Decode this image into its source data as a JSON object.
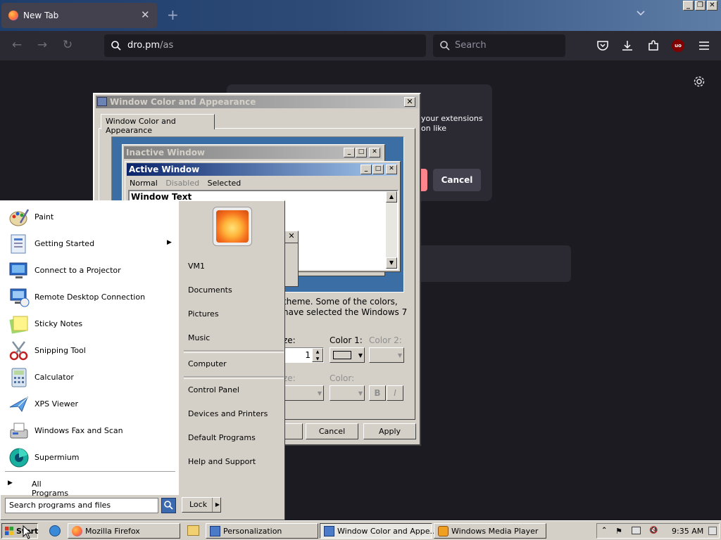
{
  "browser": {
    "tab_title": "New Tab",
    "url_host": "dro.pm",
    "url_path": "/as",
    "search_placeholder": "Search",
    "window_controls": [
      "minimize",
      "restore",
      "close"
    ],
    "extension_message_line1": "your extensions",
    "extension_message_line2": "on like",
    "extension_cancel": "Cancel",
    "addon_badge": "uo"
  },
  "dialog": {
    "title": "Window Color and Appearance",
    "tab": "Window Color and Appearance",
    "preview": {
      "inactive_title": "Inactive Window",
      "active_title": "Active Window",
      "menu_normal": "Normal",
      "menu_disabled": "Disabled",
      "menu_selected": "Selected",
      "window_text": "Window Text"
    },
    "desc_line1": "theme.  Some of the colors,",
    "desc_line2": "have selected the Windows 7",
    "size_label_1": "ze:",
    "size_value": "1",
    "color1_label": "Color 1:",
    "color2_label": "Color 2:",
    "size_label_2": "ze:",
    "color_label": "Color:",
    "bold_label": "B",
    "italic_label": "I",
    "buttons": {
      "cancel": "Cancel",
      "apply": "Apply"
    }
  },
  "start_menu": {
    "programs": [
      {
        "label": "Paint",
        "icon": "paint-icon"
      },
      {
        "label": "Getting Started",
        "icon": "getting-started-icon",
        "submenu": true
      },
      {
        "label": "Connect to a Projector",
        "icon": "projector-icon"
      },
      {
        "label": "Remote Desktop Connection",
        "icon": "remote-desktop-icon"
      },
      {
        "label": "Sticky Notes",
        "icon": "sticky-notes-icon"
      },
      {
        "label": "Snipping Tool",
        "icon": "scissors-icon"
      },
      {
        "label": "Calculator",
        "icon": "calculator-icon"
      },
      {
        "label": "XPS Viewer",
        "icon": "xps-viewer-icon"
      },
      {
        "label": "Windows Fax and Scan",
        "icon": "fax-icon"
      },
      {
        "label": "Supermium",
        "icon": "supermium-icon"
      }
    ],
    "all_programs": "All Programs",
    "search_placeholder": "Search programs and files",
    "right_links": {
      "user": "VM1",
      "documents": "Documents",
      "pictures": "Pictures",
      "music": "Music",
      "computer": "Computer",
      "control_panel": "Control Panel",
      "devices": "Devices and Printers",
      "defaults": "Default Programs",
      "help": "Help and Support"
    },
    "lock_label": "Lock"
  },
  "taskbar": {
    "start_label": "Start",
    "buttons": [
      {
        "label": "Mozilla Firefox",
        "icon": "firefox-icon"
      },
      {
        "label": "Personalization",
        "icon": "personalization-icon"
      },
      {
        "label": "Window Color and Appe...",
        "icon": "window-color-icon"
      },
      {
        "label": "Windows Media Player",
        "icon": "media-player-icon"
      }
    ],
    "clock": "9:35 AM"
  }
}
